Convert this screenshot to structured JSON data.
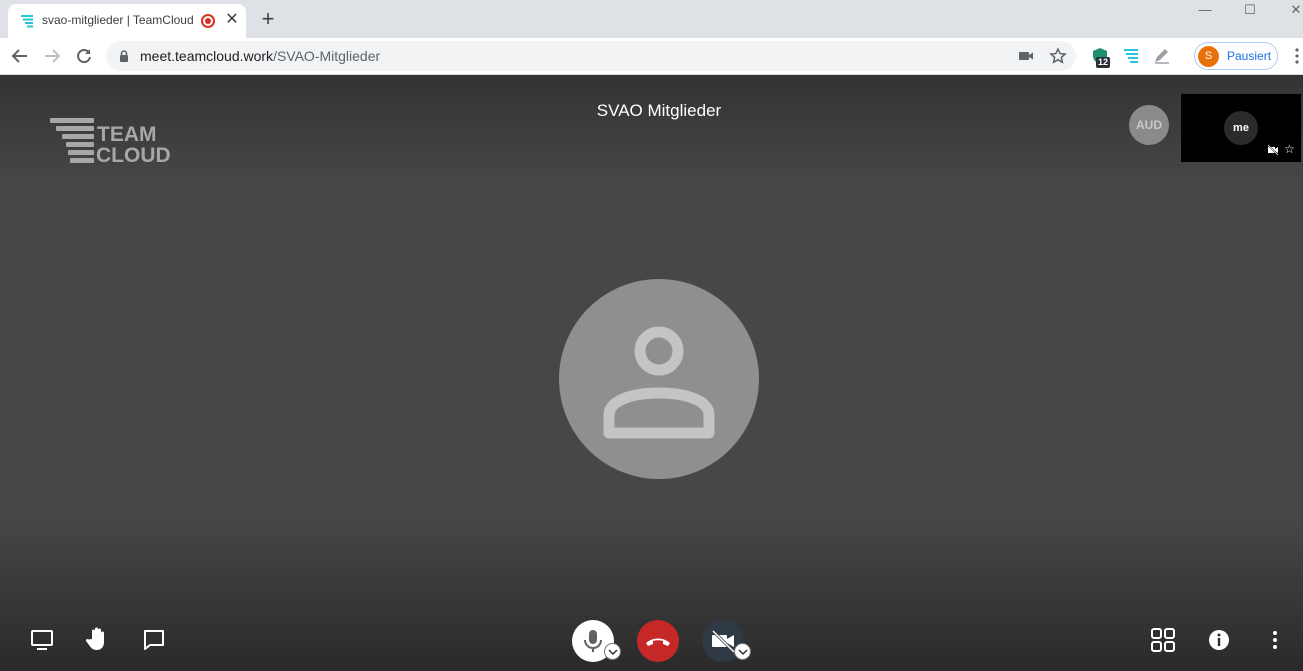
{
  "browser": {
    "tab_title": "svao-mitglieder | TeamCloud",
    "tab_close": "✕",
    "new_tab": "+",
    "url_host": "meet.teamcloud.work",
    "url_path": "/SVAO-Mitglieder",
    "extension_badge": "12",
    "profile_initial": "S",
    "profile_label": "Pausiert",
    "window_controls": {
      "minimize": "—",
      "maximize": "☐",
      "close": "✕"
    }
  },
  "meeting": {
    "logo_line1": "TEAM",
    "logo_line2": "CLOUD",
    "room_title": "SVAO Mitglieder",
    "participant_badge": "AUD",
    "self_label": "me",
    "self_star": "☆"
  },
  "controls": {
    "left": [
      "screen-share-icon",
      "raise-hand-icon",
      "chat-icon"
    ],
    "center": [
      "microphone-icon",
      "hangup-icon",
      "camera-off-icon"
    ],
    "right": [
      "tile-view-icon",
      "info-icon",
      "more-vertical-icon"
    ]
  },
  "colors": {
    "stage_bg": "#474747",
    "hangup": "#c62828",
    "avatar": "#8f8f8f",
    "profile_avatar": "#e8710a",
    "link_blue": "#1a73e8"
  }
}
